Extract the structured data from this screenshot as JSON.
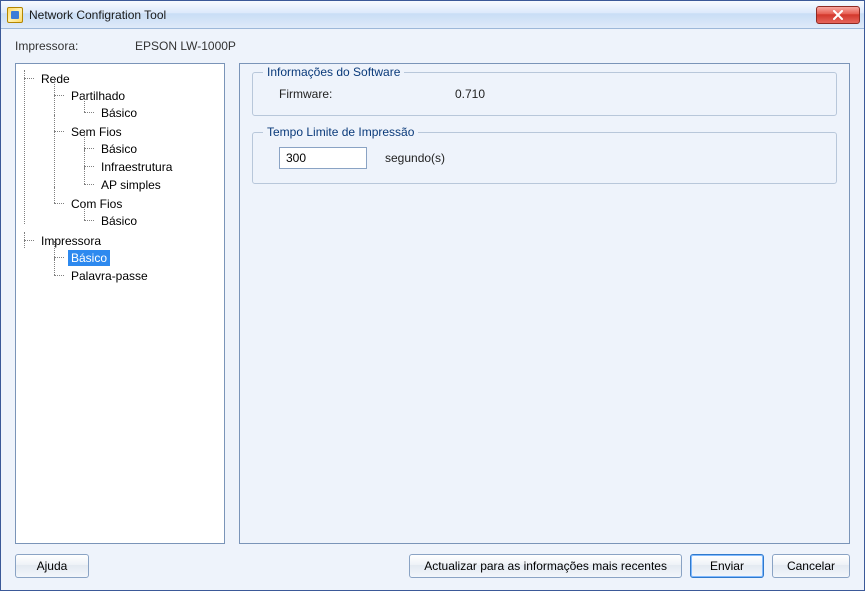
{
  "window": {
    "title": "Network Configration Tool"
  },
  "header": {
    "printer_label": "Impressora:",
    "printer_value": "EPSON LW-1000P"
  },
  "tree": {
    "rede": "Rede",
    "partilhado": "Partilhado",
    "partilhado_basico": "Básico",
    "sem_fios": "Sem Fios",
    "sem_fios_basico": "Básico",
    "sem_fios_infra": "Infraestrutura",
    "sem_fios_ap": "AP simples",
    "com_fios": "Com Fios",
    "com_fios_basico": "Básico",
    "impressora": "Impressora",
    "impressora_basico": "Básico",
    "impressora_passe": "Palavra-passe"
  },
  "detail": {
    "software_info_legend": "Informações do Software",
    "firmware_label": "Firmware:",
    "firmware_value": "0.710",
    "timeout_legend": "Tempo Limite de Impressão",
    "timeout_value": "300",
    "timeout_unit": "segundo(s)"
  },
  "buttons": {
    "help": "Ajuda",
    "refresh": "Actualizar para as informações mais recentes",
    "send": "Enviar",
    "cancel": "Cancelar"
  }
}
